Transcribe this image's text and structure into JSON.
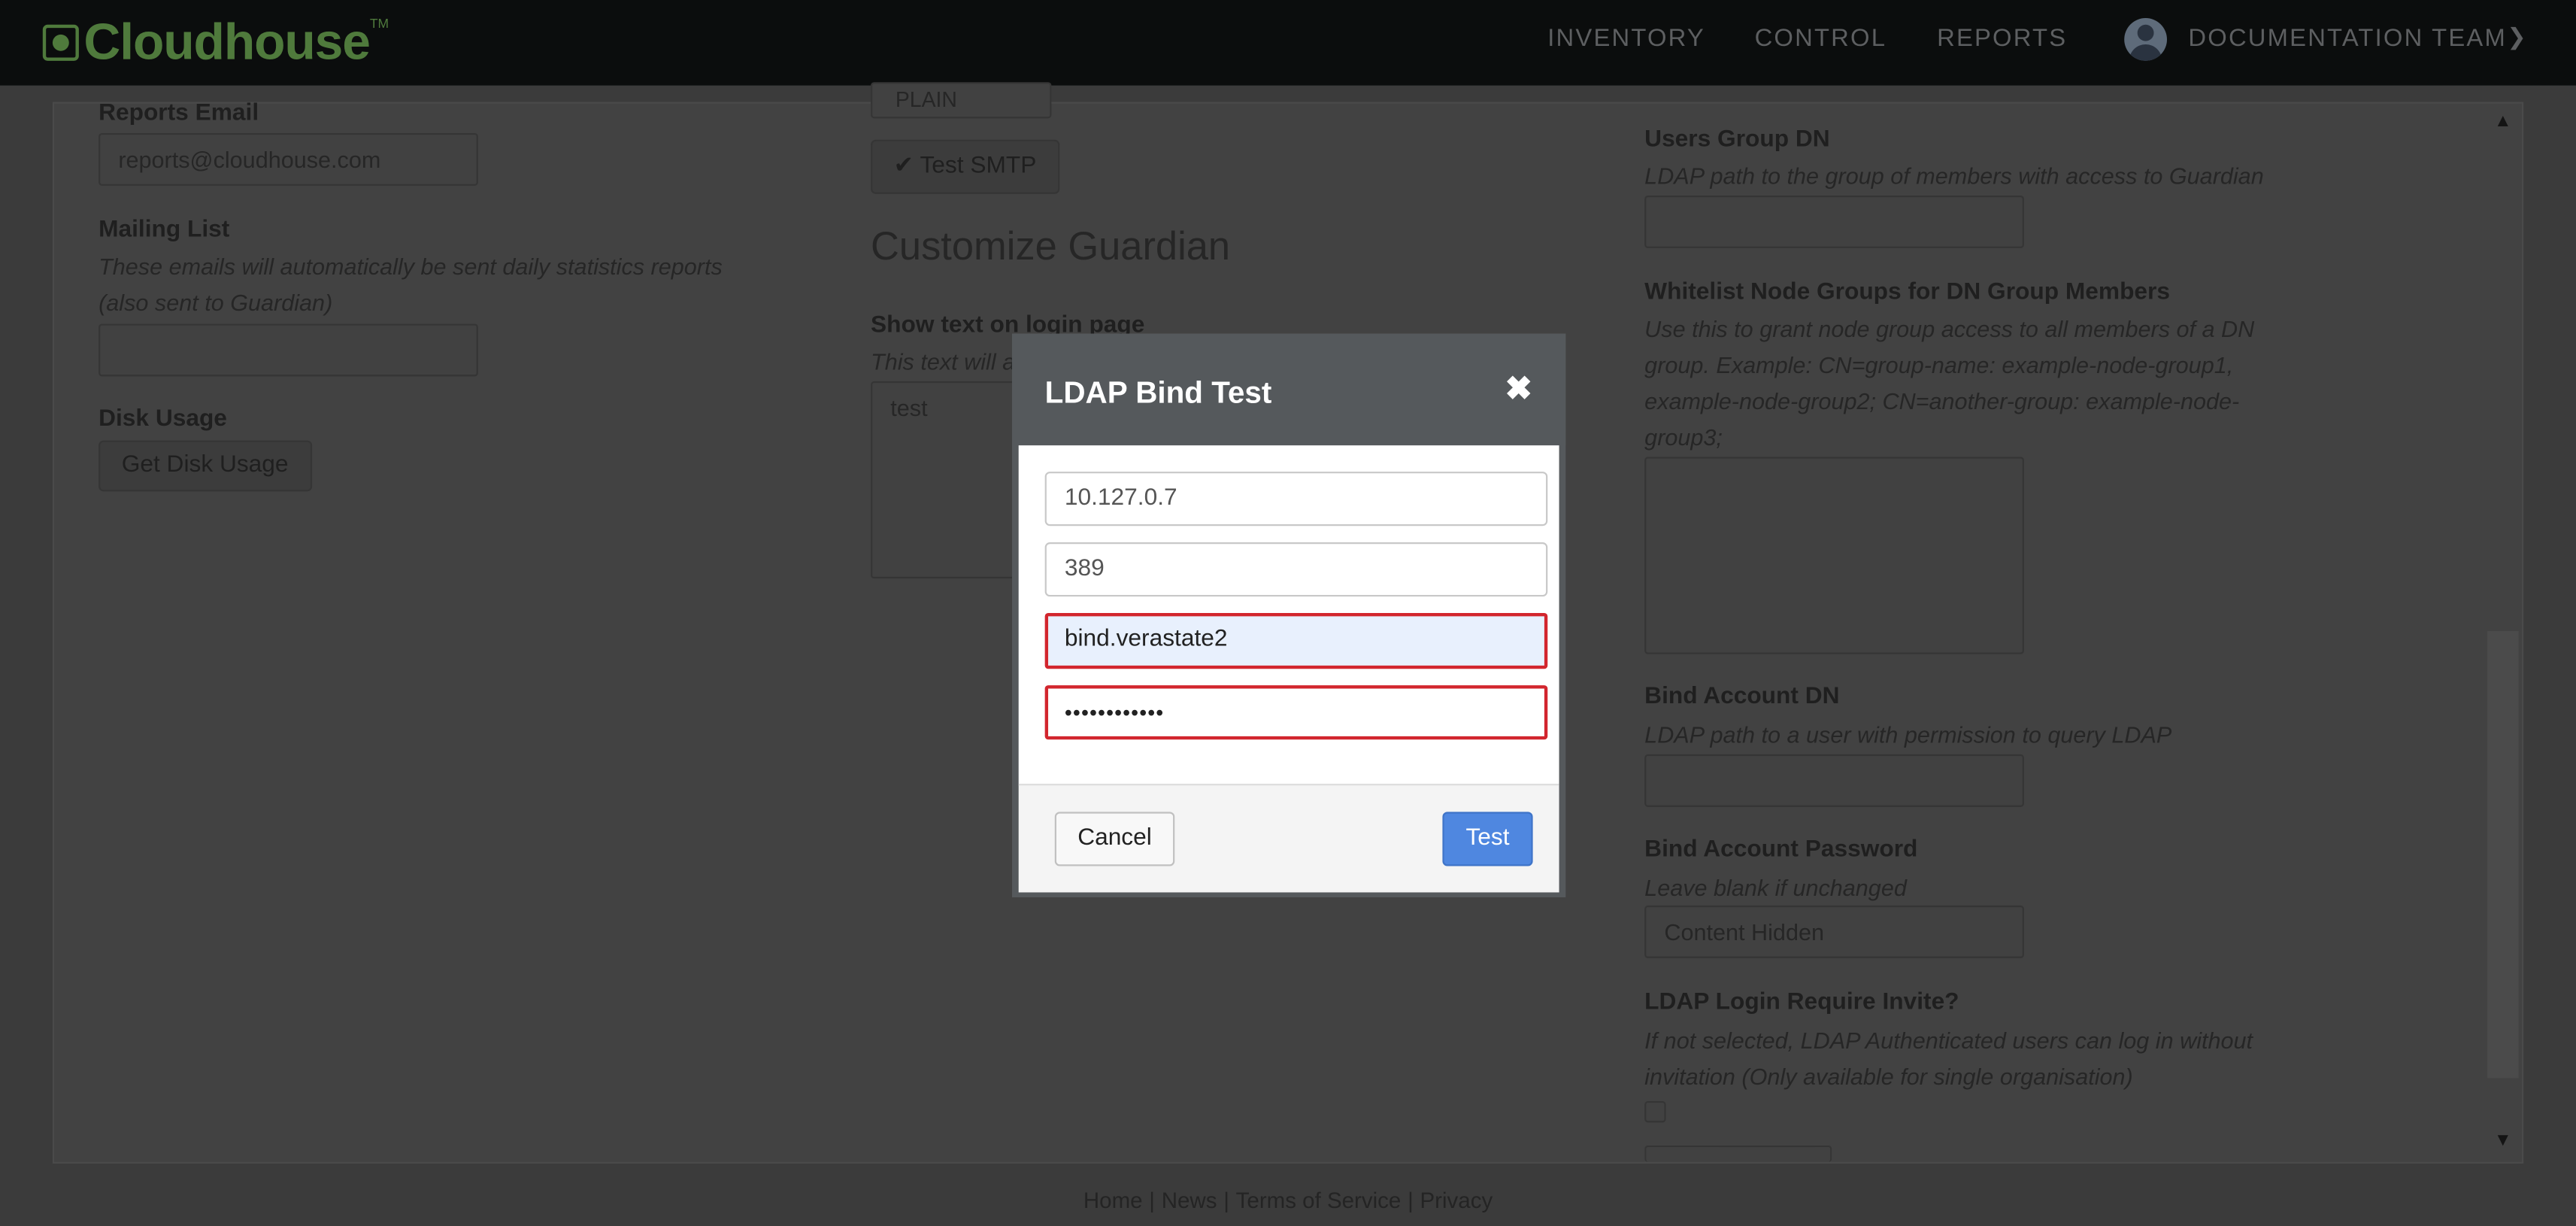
{
  "header": {
    "brand": "Cloudhouse",
    "trademark": "TM",
    "nav": [
      "INVENTORY",
      "CONTROL",
      "REPORTS"
    ],
    "team": "DOCUMENTATION TEAM"
  },
  "left_column": {
    "reports_email": {
      "label": "Reports Email",
      "value": "reports@cloudhouse.com"
    },
    "mailing_list": {
      "label": "Mailing List",
      "help_line1": "These emails will automatically be sent daily statistics reports",
      "help_line2": "(also sent to Guardian)",
      "value": ""
    },
    "disk_usage": {
      "label": "Disk Usage",
      "button": "Get Disk Usage"
    }
  },
  "middle_column": {
    "auth_select_value": "PLAIN",
    "test_smtp_button": "Test SMTP",
    "customize_heading": "Customize Guardian",
    "login_text_label": "Show text on login page",
    "login_text_help": "This text will a",
    "login_text_value": "test"
  },
  "right_column": {
    "users_group_dn": {
      "label": "Users Group DN",
      "help": "LDAP path to the group of members with access to Guardian"
    },
    "whitelist": {
      "label": "Whitelist Node Groups for DN Group Members",
      "help_line1": "Use this to grant node group access to all members of a DN",
      "help_line2": "group. Example: CN=group-name: example-node-group1,",
      "help_line3": "example-node-group2; CN=another-group: example-node-",
      "help_line4": "group3;"
    },
    "bind_account_dn": {
      "label": "Bind Account DN",
      "help": "LDAP path to a user with permission to query LDAP"
    },
    "bind_account_password": {
      "label": "Bind Account Password",
      "help": "Leave blank if unchanged",
      "placeholder": "Content Hidden"
    },
    "ldap_require_invite": {
      "label": "LDAP Login Require Invite?",
      "help_line1": "If not selected, LDAP Authenticated users can log in without",
      "help_line2": "invitation (Only available for single organisation)",
      "checked": false
    }
  },
  "footer": {
    "links": [
      "Home",
      "News",
      "Terms of Service",
      "Privacy"
    ],
    "separator": "|"
  },
  "modal": {
    "title": "LDAP Bind Test",
    "close_glyph": "✖",
    "server": "10.127.0.7",
    "port": "389",
    "username": "bind.verastate2",
    "password_mask": "••••••••••••",
    "cancel_label": "Cancel",
    "test_label": "Test"
  },
  "colors": {
    "brand_green": "#4f7a3c",
    "primary_blue": "#4f87e0",
    "error_red": "#d2262e",
    "modal_header": "#55595c"
  }
}
